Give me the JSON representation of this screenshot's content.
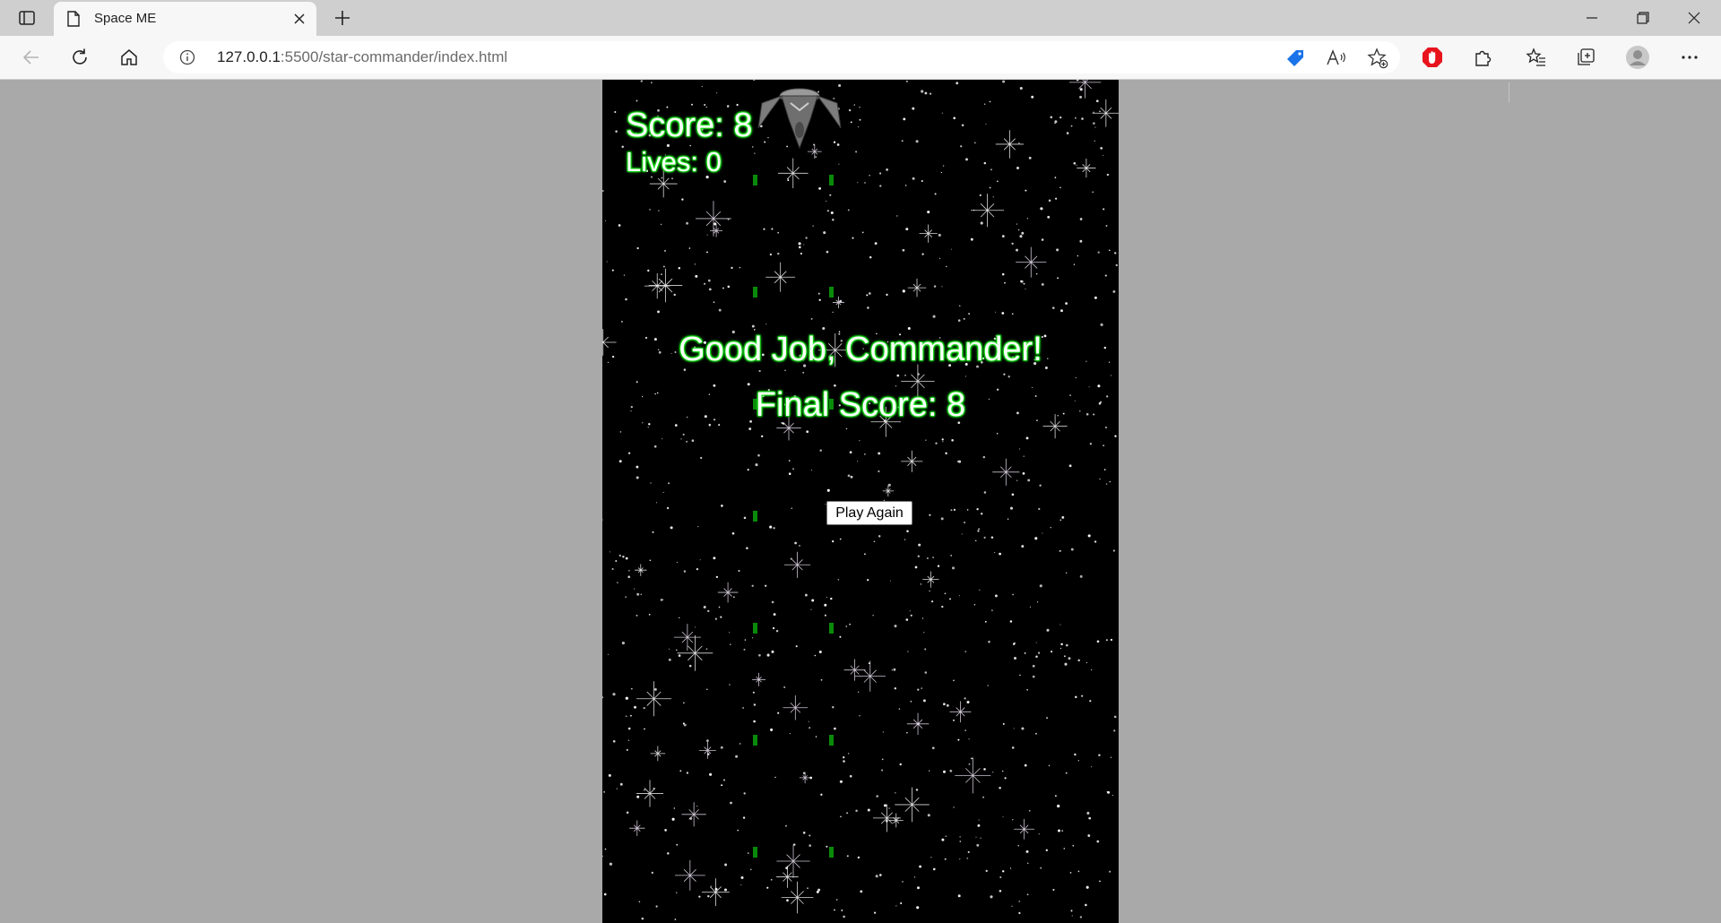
{
  "browser": {
    "tab_title": "Space ME",
    "url_host": "127.0.0.1",
    "url_path": ":5500/star-commander/index.html"
  },
  "game": {
    "score_text": "Score: 8",
    "lives_text": "Lives: 0",
    "headline": "Good Job, Commander!",
    "final_score_text": "Final Score: 8",
    "play_again_label": "Play Again",
    "colors": {
      "background": "#000000",
      "text_glow": "#22ee22",
      "bullet": "#0a8a0a"
    }
  }
}
